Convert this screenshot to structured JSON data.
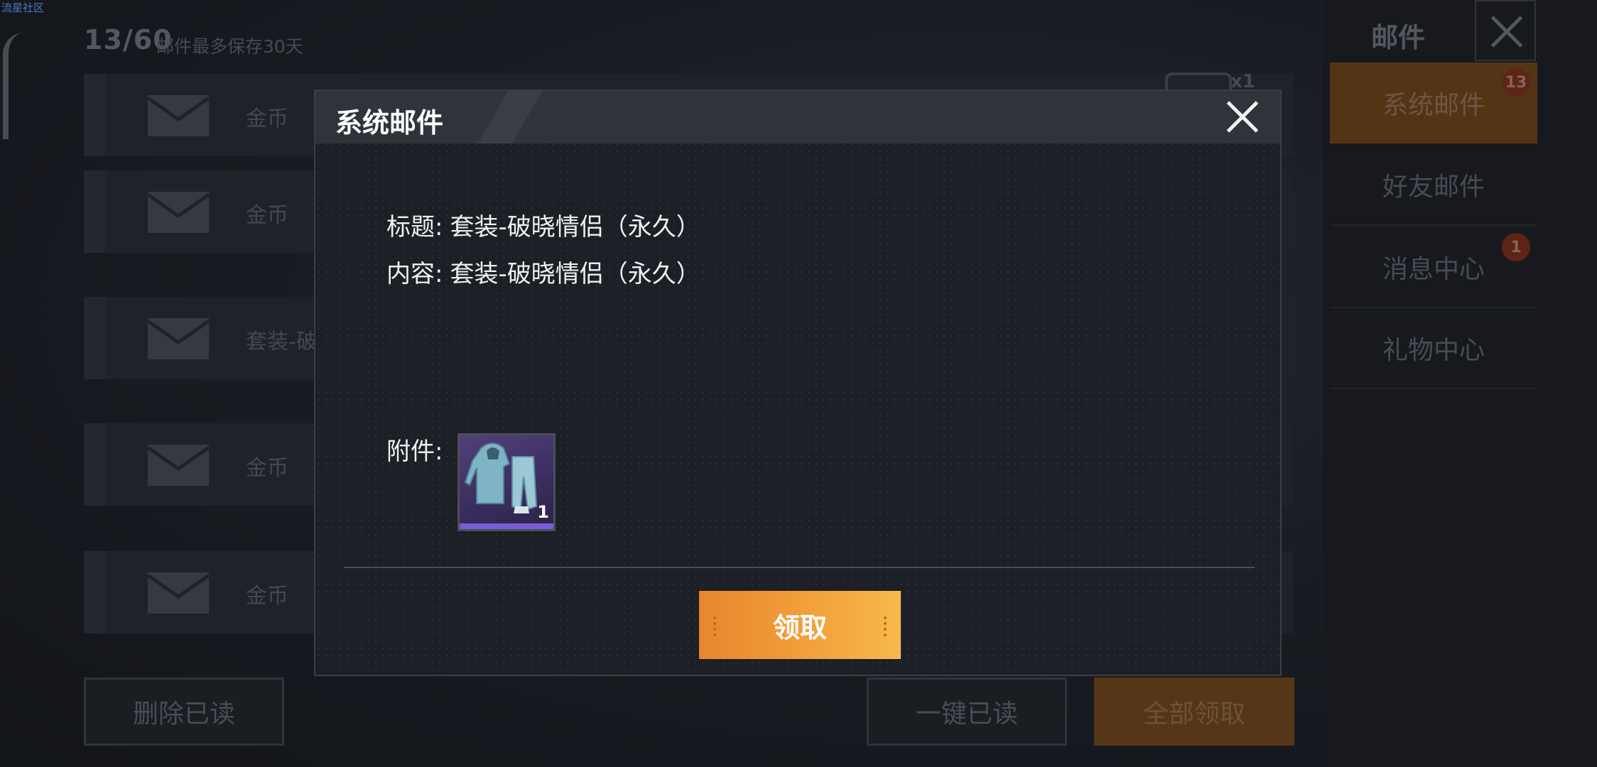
{
  "watermark": "流星社区",
  "mailbox": {
    "count": "13/60",
    "note": "邮件最多保存30天",
    "attach_multiplier": "x1",
    "rows": [
      {
        "label": "金币"
      },
      {
        "label": "金币"
      },
      {
        "label": "套装-破晓"
      },
      {
        "label": "金币"
      },
      {
        "label": "金币"
      }
    ],
    "delete_read": "删除已读",
    "mark_all_read": "一键已读",
    "claim_all": "全部领取"
  },
  "right_panel": {
    "title": "邮件",
    "nav": [
      {
        "label": "系统邮件",
        "badge": "13",
        "active": true
      },
      {
        "label": "好友邮件",
        "badge": ""
      },
      {
        "label": "消息中心",
        "badge": "1"
      },
      {
        "label": "礼物中心",
        "badge": ""
      }
    ]
  },
  "modal": {
    "title": "系统邮件",
    "subject_label": "标题:",
    "subject_value": "套装-破晓情侣（永久）",
    "content_label": "内容:",
    "content_value": "套装-破晓情侣（永久）",
    "attachment_label": "附件:",
    "attachment_item": {
      "icon": "hoodie-outfit-icon",
      "quantity": "1",
      "rarity_color": "#7a5cd6"
    },
    "claim_button": "领取"
  },
  "colors": {
    "accent": "#f3a33c",
    "badge": "#d9442b"
  }
}
